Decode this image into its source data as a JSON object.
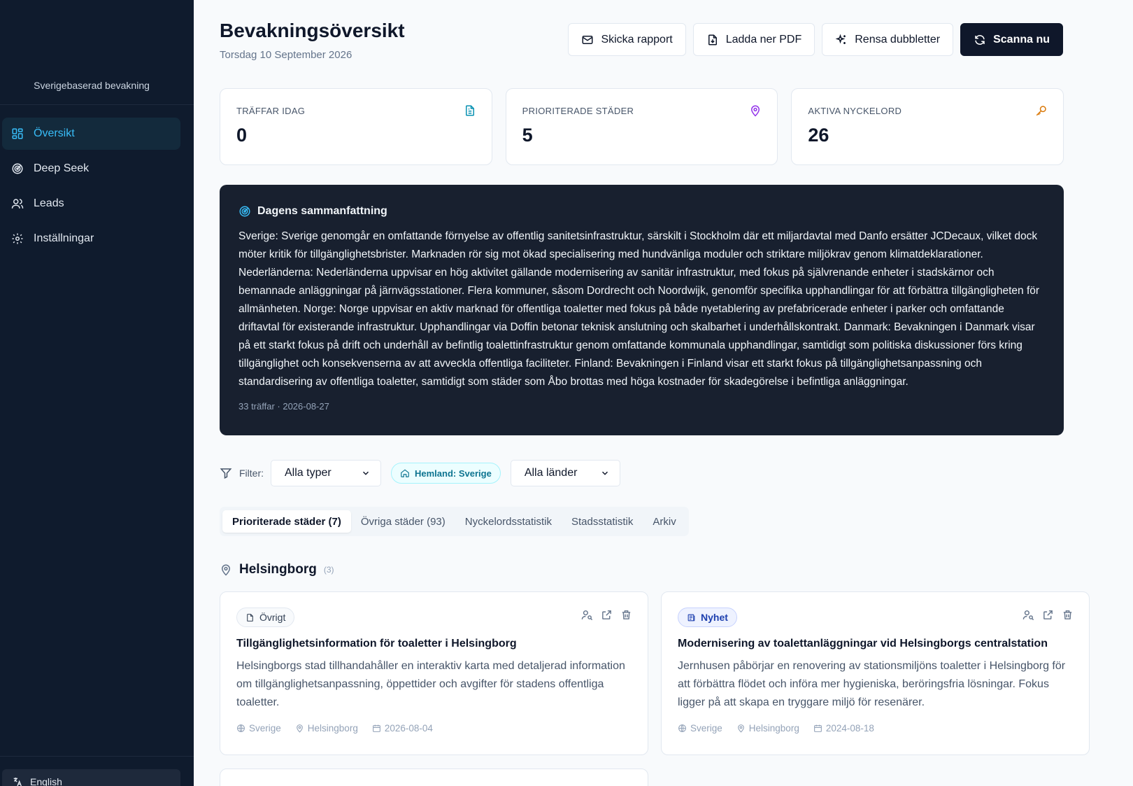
{
  "sidebar": {
    "subtitle": "Sverigebaserad bevakning",
    "items": [
      {
        "label": "Översikt",
        "icon": "grid-icon",
        "active": true
      },
      {
        "label": "Deep Seek",
        "icon": "radar-icon"
      },
      {
        "label": "Leads",
        "icon": "users-icon"
      },
      {
        "label": "Inställningar",
        "icon": "gear-icon"
      }
    ],
    "language": "English"
  },
  "header": {
    "title": "Bevakningsöversikt",
    "date": "Torsdag 10 September 2026",
    "buttons": {
      "send_report": "Skicka rapport",
      "download_pdf": "Ladda ner PDF",
      "dedupe": "Rensa dubbletter",
      "scan": "Scanna nu"
    }
  },
  "stats": [
    {
      "label": "TRÄFFAR IDAG",
      "value": "0",
      "icon": "document-icon",
      "color": "#0891b2"
    },
    {
      "label": "PRIORITERADE STÄDER",
      "value": "5",
      "icon": "map-pin-icon",
      "color": "#9333ea"
    },
    {
      "label": "AKTIVA NYCKELORD",
      "value": "26",
      "icon": "key-icon",
      "color": "#d97706"
    }
  ],
  "summary": {
    "title": "Dagens sammanfattning",
    "text": "Sverige: Sverige genomgår en omfattande förnyelse av offentlig sanitetsinfrastruktur, särskilt i Stockholm där ett miljardavtal med Danfo ersätter JCDecaux, vilket dock möter kritik för tillgänglighetsbrister. Marknaden rör sig mot ökad specialisering med hundvänliga moduler och striktare miljökrav genom klimatdeklarationer. Nederländerna: Nederländerna uppvisar en hög aktivitet gällande modernisering av sanitär infrastruktur, med fokus på självrenande enheter i stadskärnor och bemannade anläggningar på järnvägsstationer. Flera kommuner, såsom Dordrecht och Noordwijk, genomför specifika upphandlingar för att förbättra tillgängligheten för allmänheten. Norge: Norge uppvisar en aktiv marknad för offentliga toaletter med fokus på både nyetablering av prefabricerade enheter i parker och omfattande driftavtal för existerande infrastruktur. Upphandlingar via Doffin betonar teknisk anslutning och skalbarhet i underhållskontrakt. Danmark: Bevakningen i Danmark visar på ett starkt fokus på drift och underhåll av befintlig toalettinfrastruktur genom omfattande kommunala upphandlingar, samtidigt som politiska diskussioner förs kring tillgänglighet och konsekvenserna av att avveckla offentliga faciliteter. Finland: Bevakningen i Finland visar ett starkt fokus på tillgänglighetsanpassning och standardisering av offentliga toaletter, samtidigt som städer som Åbo brottas med höga kostnader för skadegörelse i befintliga anläggningar.",
    "meta": "33 träffar · 2026-08-27"
  },
  "filter": {
    "label": "Filter:",
    "type_select": "Alla typer",
    "home_chip": "Hemland: Sverige",
    "country_select": "Alla länder"
  },
  "tabs": [
    {
      "label": "Prioriterade städer (7)",
      "active": true
    },
    {
      "label": "Övriga städer (93)"
    },
    {
      "label": "Nyckelordsstatistik"
    },
    {
      "label": "Stadsstatistik"
    },
    {
      "label": "Arkiv"
    }
  ],
  "city": {
    "name": "Helsingborg",
    "count": "(3)"
  },
  "cards": [
    {
      "tag": "Övrigt",
      "title": "Tillgänglighetsinformation för toaletter i Helsingborg",
      "desc": "Helsingborgs stad tillhandahåller en interaktiv karta med detaljerad information om tillgänglighetsanpassning, öppettider och avgifter för stadens offentliga toaletter.",
      "country": "Sverige",
      "city": "Helsingborg",
      "date": "2026-08-04"
    },
    {
      "tag": "Nyhet",
      "title": "Modernisering av toalettanläggningar vid Helsingborgs centralstation",
      "desc": "Jernhusen påbörjar en renovering av stationsmiljöns toaletter i Helsingborg för att förbättra flödet och införa mer hygieniska, beröringsfria lösningar. Fokus ligger på att skapa en tryggare miljö för resenärer.",
      "country": "Sverige",
      "city": "Helsingborg",
      "date": "2024-08-18"
    }
  ]
}
